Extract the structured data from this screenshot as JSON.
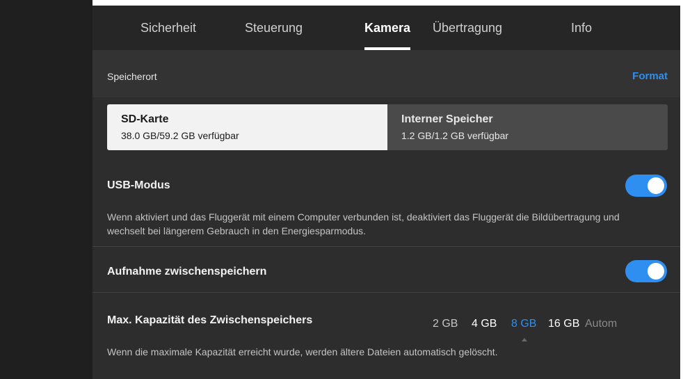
{
  "tabs": [
    {
      "label": "Sicherheit"
    },
    {
      "label": "Steuerung"
    },
    {
      "label": "Kamera"
    },
    {
      "label": "Übertragung"
    },
    {
      "label": "Info"
    }
  ],
  "active_tab": "Kamera",
  "storage_section": {
    "title": "Speicherort",
    "format_label": "Format",
    "options": [
      {
        "name": "SD-Karte",
        "detail": "38.0 GB/59.2 GB verfügbar",
        "selected": true
      },
      {
        "name": "Interner Speicher",
        "detail": "1.2 GB/1.2 GB verfügbar",
        "selected": false
      }
    ]
  },
  "usb_mode": {
    "title": "USB-Modus",
    "enabled": true,
    "description": "Wenn aktiviert und das Fluggerät mit einem Computer verbunden ist, deaktiviert das Fluggerät die Bildübertragung und wechselt bei längerem Gebrauch in den Energiesparmodus."
  },
  "cache_recording": {
    "title": "Aufnahme zwischenspeichern",
    "enabled": true
  },
  "cache_capacity": {
    "title": "Max. Kapazität des Zwischenspeichers",
    "options": [
      "2 GB",
      "4 GB",
      "8 GB",
      "16 GB",
      "Autom"
    ],
    "selected": "8 GB",
    "description": "Wenn die maximale Kapazität erreicht wurde, werden ältere Dateien automatisch gelöscht."
  },
  "colors": {
    "accent": "#2e8ff0",
    "panel_background": "#2d2d2d",
    "selected_option_background": "#f2f2f2"
  }
}
